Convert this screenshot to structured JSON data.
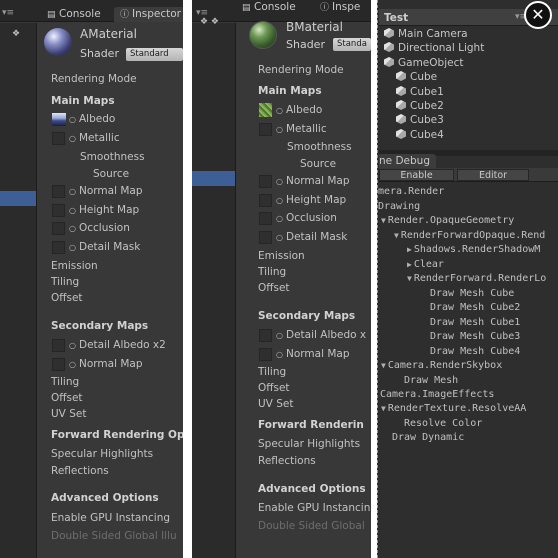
{
  "inspector_a": {
    "tabs": [
      {
        "glyph": "▤",
        "label": "Console"
      },
      {
        "glyph": "ⓘ",
        "label": "Inspector"
      }
    ],
    "material_name": "AMaterial",
    "shader_label": "Shader",
    "shader_value": "Standard",
    "rows": {
      "rendering_mode": "Rendering Mode",
      "main_maps": "Main Maps",
      "albedo": "Albedo",
      "metallic": "Metallic",
      "smoothness": "Smoothness",
      "source": "Source",
      "normal_map": "Normal Map",
      "height_map": "Height Map",
      "occlusion": "Occlusion",
      "detail_mask": "Detail Mask",
      "emission": "Emission",
      "tiling": "Tiling",
      "offset": "Offset",
      "secondary_maps": "Secondary Maps",
      "detail_albedo": "Detail Albedo x2",
      "normal_map_2": "Normal Map",
      "tiling_2": "Tiling",
      "offset_2": "Offset",
      "uv_set": "UV Set",
      "forward_rendering": "Forward Rendering Op",
      "specular_highlights": "Specular Highlights",
      "reflections": "Reflections",
      "advanced_options": "Advanced Options",
      "gpu_instancing": "Enable GPU Instancing",
      "double_sided": "Double Sided Global Illu"
    }
  },
  "inspector_b": {
    "tab_label": "Console",
    "tab2_label": "Inspe",
    "material_name": "BMaterial",
    "shader_label": "Shader",
    "shader_value": "Standa",
    "rows": {
      "rendering_mode": "Rendering Mode",
      "main_maps": "Main Maps",
      "albedo": "Albedo",
      "metallic": "Metallic",
      "smoothness": "Smoothness",
      "source": "Source",
      "normal_map": "Normal Map",
      "height_map": "Height Map",
      "occlusion": "Occlusion",
      "detail_mask": "Detail Mask",
      "emission": "Emission",
      "tiling": "Tiling",
      "offset": "Offset",
      "secondary_maps": "Secondary Maps",
      "detail_albedo": "Detail Albedo x",
      "normal_map_2": "Normal Map",
      "tiling_2": "Tiling",
      "offset_2": "Offset",
      "uv_set": "UV Set",
      "forward_rendering": "Forward Renderin",
      "specular_highlights": "Specular Highlights",
      "reflections": "Reflections",
      "advanced_options": "Advanced Options",
      "gpu_instancing": "Enable GPU Instancin",
      "double_sided": "Double Sided Global"
    }
  },
  "hierarchy": {
    "title": "Test",
    "items": [
      "Main Camera",
      "Directional Light",
      "GameObject",
      "Cube",
      "Cube1",
      "Cube2",
      "Cube3",
      "Cube4"
    ]
  },
  "frame_debug": {
    "tab_label": "ne Debug",
    "enable_label": "Enable",
    "editor_label": "Editor",
    "events": [
      "mera.Render",
      "Drawing",
      "Render.OpaqueGeometry",
      "RenderForwardOpaque.Rend",
      "Shadows.RenderShadowM",
      "Clear",
      "RenderForward.RenderLo",
      "Draw Mesh Cube",
      "Draw Mesh Cube2",
      "Draw Mesh Cube1",
      "Draw Mesh Cube3",
      "Draw Mesh Cube4",
      "Camera.RenderSkybox",
      "Draw Mesh",
      "Camera.ImageEffects",
      "RenderTexture.ResolveAA",
      "Resolve Color",
      "Draw Dynamic"
    ]
  },
  "colors": {
    "panel_bg": "#383838",
    "selection": "#3e5f96",
    "text": "#c2c2c2"
  }
}
